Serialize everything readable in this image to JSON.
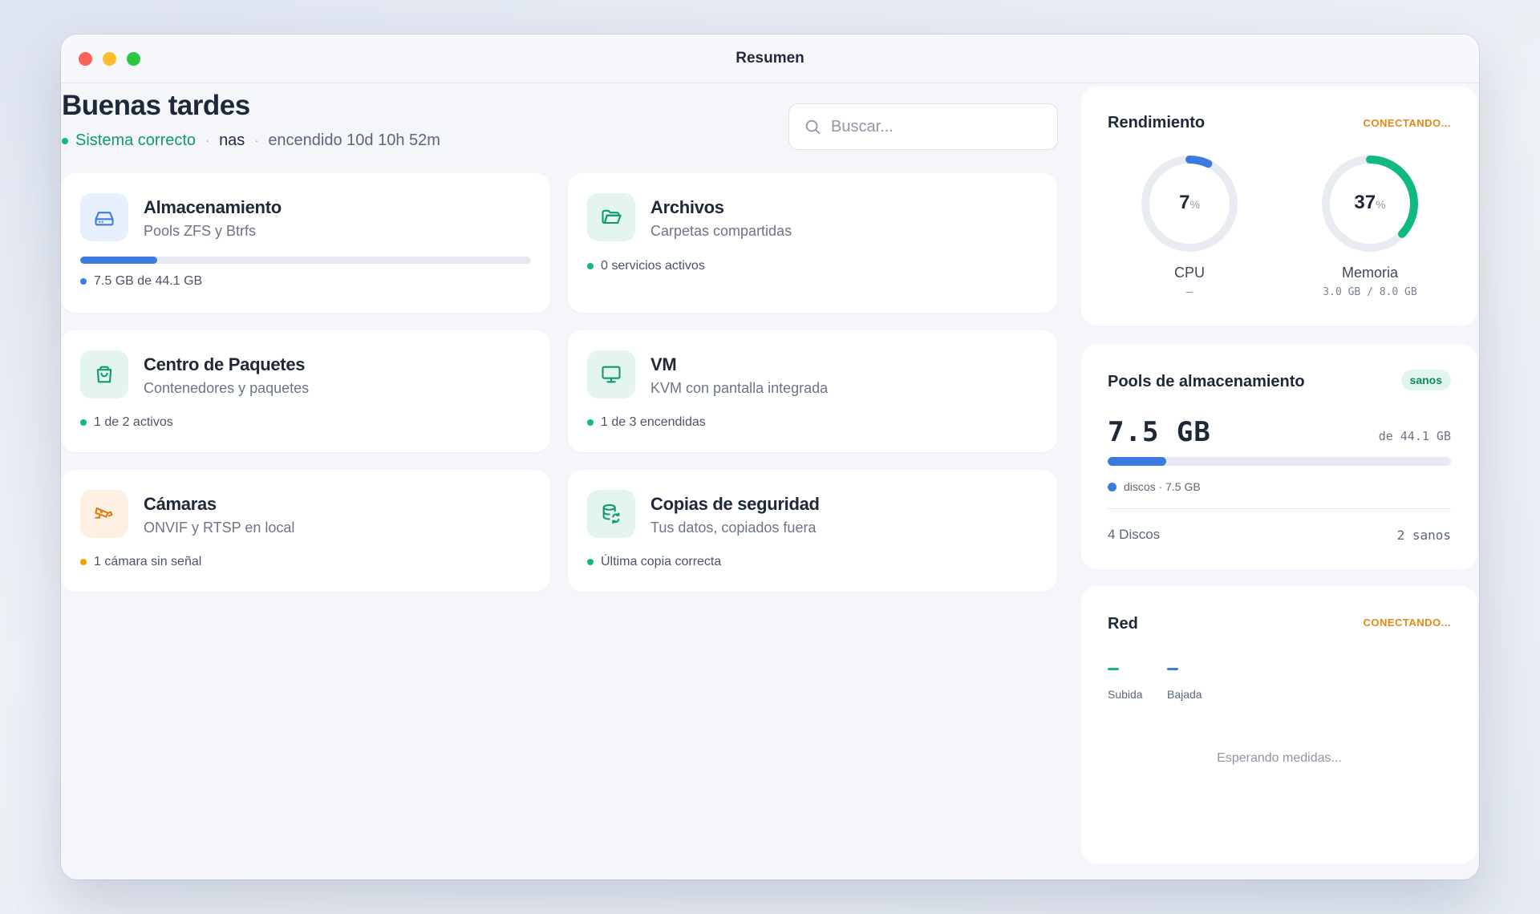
{
  "window": {
    "title": "Resumen"
  },
  "header": {
    "greeting": "Buenas tardes",
    "status": "Sistema correcto",
    "host": "nas",
    "uptime": "encendido 10d 10h 52m"
  },
  "search": {
    "placeholder": "Buscar..."
  },
  "cards": {
    "storage": {
      "title": "Almacenamiento",
      "subtitle": "Pools ZFS y Btrfs",
      "status": "7.5 GB de 44.1 GB",
      "usage_fraction": 0.17,
      "icon": "drive-icon"
    },
    "files": {
      "title": "Archivos",
      "subtitle": "Carpetas compartidas",
      "status": "0 servicios activos",
      "icon": "folder-icon"
    },
    "packages": {
      "title": "Centro de Paquetes",
      "subtitle": "Contenedores y paquetes",
      "status": "1 de 2 activos",
      "icon": "bag-icon"
    },
    "vm": {
      "title": "VM",
      "subtitle": "KVM con pantalla integrada",
      "status": "1 de 3 encendidas",
      "icon": "monitor-icon"
    },
    "cameras": {
      "title": "Cámaras",
      "subtitle": "ONVIF y RTSP en local",
      "status": "1 cámara sin señal",
      "icon": "camera-icon"
    },
    "backups": {
      "title": "Copias de seguridad",
      "subtitle": "Tus datos, copiados fuera",
      "status": "Última copia correcta",
      "icon": "database-sync-icon"
    }
  },
  "performance": {
    "title": "Rendimiento",
    "state": "CONECTANDO...",
    "cpu": {
      "value": "7",
      "unit": "%",
      "label": "CPU",
      "detail": "–",
      "fraction": 0.07,
      "color": "#3b7be0"
    },
    "memory": {
      "value": "37",
      "unit": "%",
      "label": "Memoria",
      "detail": "3.0 GB / 8.0 GB",
      "fraction": 0.37,
      "color": "#10b981"
    }
  },
  "pools": {
    "title": "Pools de almacenamiento",
    "badge": "sanos",
    "used": "7.5 GB",
    "total": "de 44.1 GB",
    "usage_fraction": 0.17,
    "legend": "discos · 7.5 GB",
    "disks": "4 Discos",
    "healthy": "2 sanos"
  },
  "network": {
    "title": "Red",
    "state": "CONECTANDO...",
    "up_label": "Subida",
    "down_label": "Bajada",
    "waiting": "Esperando medidas..."
  },
  "colors": {
    "accent": "#3b7be0",
    "ok": "#10b981",
    "warn": "#f59e0b",
    "connecting": "#e08a13"
  }
}
